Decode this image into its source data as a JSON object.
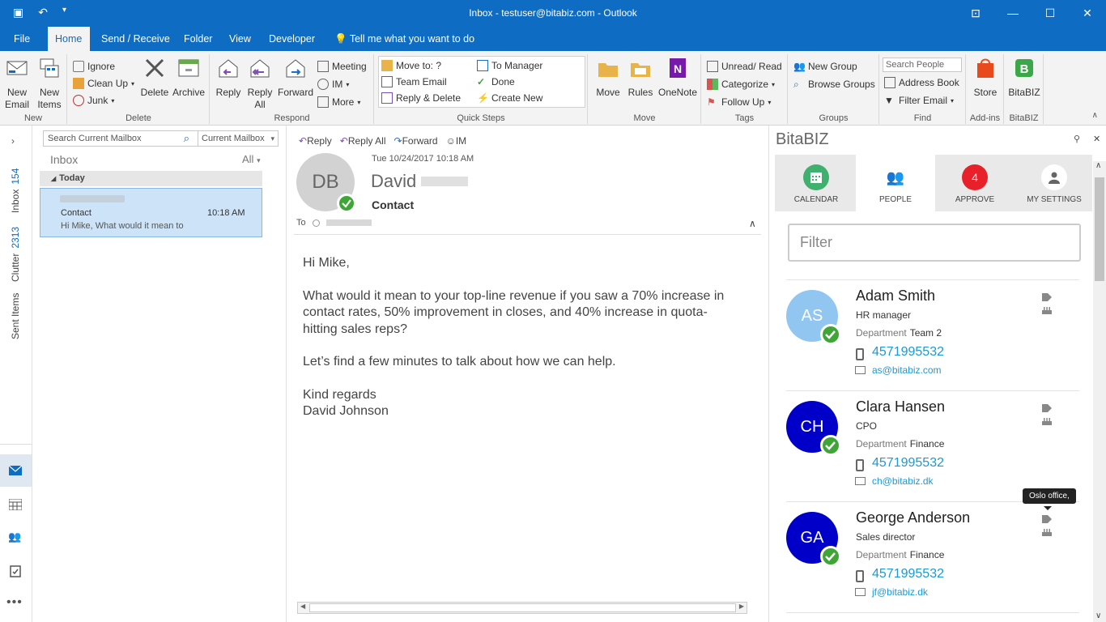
{
  "window": {
    "title": "Inbox - testuser@bitabiz.com  -  Outlook"
  },
  "menu": {
    "tabs": [
      "File",
      "Home",
      "Send / Receive",
      "Folder",
      "View",
      "Developer"
    ],
    "tell_me": "Tell me what you want to do"
  },
  "ribbon": {
    "new_email": "New\nEmail",
    "new_items": "New\nItems",
    "group_new": "New",
    "ignore": "Ignore",
    "clean_up": "Clean Up",
    "junk": "Junk",
    "delete": "Delete",
    "archive": "Archive",
    "group_delete": "Delete",
    "reply": "Reply",
    "reply_all": "Reply\nAll",
    "forward": "Forward",
    "meeting": "Meeting",
    "im": "IM",
    "more": "More",
    "group_respond": "Respond",
    "qs_move_to": "Move to: ?",
    "qs_team_email": "Team Email",
    "qs_reply_delete": "Reply & Delete",
    "qs_to_manager": "To Manager",
    "qs_done": "Done",
    "qs_create_new": "Create New",
    "group_quick_steps": "Quick Steps",
    "move": "Move",
    "rules": "Rules",
    "onenote": "OneNote",
    "group_move": "Move",
    "unread_read": "Unread/ Read",
    "categorize": "Categorize",
    "follow_up": "Follow Up",
    "group_tags": "Tags",
    "new_group": "New Group",
    "browse_groups": "Browse Groups",
    "group_groups": "Groups",
    "search_people": "Search People",
    "address_book": "Address Book",
    "filter_email": "Filter Email",
    "group_find": "Find",
    "store": "Store",
    "group_addins": "Add-ins",
    "bitabiz": "BitaBIZ",
    "group_bitabiz": "BitaBIZ"
  },
  "nav": {
    "inbox_label": "Inbox",
    "inbox_count": "154",
    "clutter_label": "Clutter",
    "clutter_count": "2313",
    "sent_label": "Sent Items"
  },
  "maillist": {
    "search_placeholder": "Search Current Mailbox",
    "scope": "Current Mailbox",
    "folder": "Inbox",
    "filter": "All",
    "group_header": "Today",
    "item": {
      "subject": "Contact",
      "time": "10:18 AM",
      "preview": "Hi Mike,  What would it mean to"
    }
  },
  "reading": {
    "actions": [
      "Reply",
      "Reply All",
      "Forward",
      "IM"
    ],
    "datetime": "Tue 10/24/2017 10:18 AM",
    "sender_initials": "DB",
    "sender_first": "David",
    "subject": "Contact",
    "to_label": "To",
    "body": [
      "Hi Mike,",
      "What would it mean to your top-line revenue if you saw a 70% increase in contact rates, 50% improvement in closes, and 40% increase in quota-hitting sales reps?",
      "Let’s find a few minutes to talk about how we can help.",
      "Kind regards\nDavid Johnson"
    ]
  },
  "bitabiz": {
    "title": "BitaBIZ",
    "tabs": [
      {
        "label": "CALENDAR"
      },
      {
        "label": "PEOPLE"
      },
      {
        "label": "APPROVE",
        "badge": "4"
      },
      {
        "label": "MY SETTINGS"
      }
    ],
    "filter_placeholder": "Filter",
    "tooltip": "Oslo office,",
    "dept_label": "Department",
    "contacts": [
      {
        "initials": "AS",
        "name": "Adam Smith",
        "role": "HR manager",
        "department": "Team 2",
        "phone": "4571995532",
        "email": "as@bitabiz.com",
        "color": "#90c6f0"
      },
      {
        "initials": "CH",
        "name": "Clara Hansen",
        "role": "CPO",
        "department": "Finance",
        "phone": "4571995532",
        "email": "ch@bitabiz.dk",
        "color": "#0000c8"
      },
      {
        "initials": "GA",
        "name": "George Anderson",
        "role": "Sales director",
        "department": "Finance",
        "phone": "4571995532",
        "email": "jf@bitabiz.dk",
        "color": "#0000c8"
      }
    ]
  },
  "colors": {
    "brand": "#0f6cc3",
    "status_green": "#3fa536",
    "link": "#1a9ad6",
    "approve_red": "#e8202a"
  }
}
